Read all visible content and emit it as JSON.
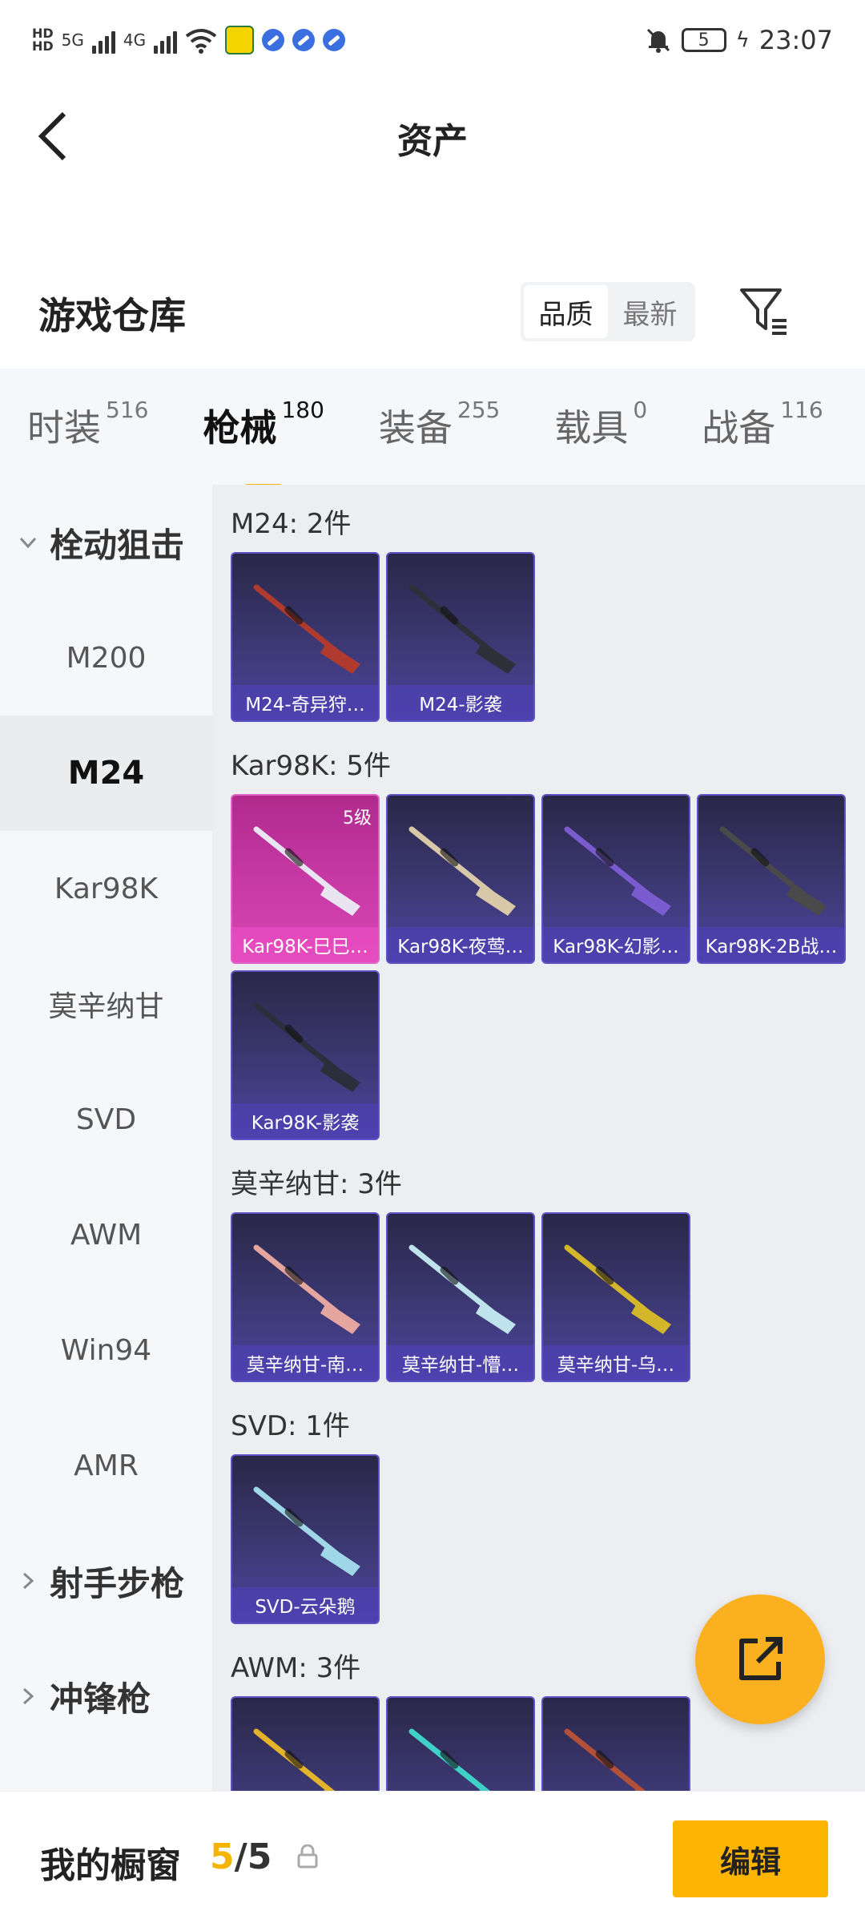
{
  "status_bar": {
    "time": "23:07",
    "battery": "5",
    "network": "5G",
    "network2": "4G",
    "icons": [
      "hd-icon",
      "signal-icon",
      "signal-icon",
      "wifi-icon",
      "app-icon",
      "app-icon",
      "app-icon",
      "app-icon",
      "mute-icon",
      "battery-icon",
      "charging-icon"
    ]
  },
  "header": {
    "title": "资产"
  },
  "section": {
    "title": "游戏仓库",
    "sort_quality": "品质",
    "sort_newest": "最新"
  },
  "tabs": [
    {
      "label": "时装",
      "count": "516"
    },
    {
      "label": "枪械",
      "count": "180"
    },
    {
      "label": "装备",
      "count": "255"
    },
    {
      "label": "载具",
      "count": "0"
    },
    {
      "label": "战备",
      "count": "116"
    }
  ],
  "sidebar": {
    "cat1": "栓动狙击",
    "items": [
      "M200",
      "M24",
      "Kar98K",
      "莫辛纳甘",
      "SVD",
      "AWM",
      "Win94",
      "AMR"
    ],
    "cat2": "射手步枪",
    "cat3": "冲锋枪"
  },
  "groups": [
    {
      "title": "M24: 2件",
      "items": [
        {
          "name": "M24-奇异狩…",
          "color": "#b03a2e"
        },
        {
          "name": "M24-影袭",
          "color": "#2f2f3a"
        }
      ]
    },
    {
      "title": "Kar98K: 5件",
      "items": [
        {
          "name": "Kar98K-巳巳…",
          "level": "5级",
          "color": "#e9e4f2"
        },
        {
          "name": "Kar98K-夜莺…",
          "color": "#d8c8a8"
        },
        {
          "name": "Kar98K-幻影…",
          "color": "#7a5bd0"
        },
        {
          "name": "Kar98K-2B战…",
          "color": "#4a4a4a"
        },
        {
          "name": "Kar98K-影袭",
          "color": "#2b2e3b"
        }
      ]
    },
    {
      "title": "莫辛纳甘: 3件",
      "items": [
        {
          "name": "莫辛纳甘-南…",
          "color": "#e6a6a0"
        },
        {
          "name": "莫辛纳甘-懵…",
          "color": "#bfe3ec"
        },
        {
          "name": "莫辛纳甘-乌…",
          "color": "#d4b62b"
        }
      ]
    },
    {
      "title": "SVD: 1件",
      "items": [
        {
          "name": "SVD-云朵鹅",
          "color": "#9fd6e8"
        }
      ]
    },
    {
      "title": "AWM: 3件",
      "items": [
        {
          "name": "",
          "color": "#e3b32a"
        },
        {
          "name": "",
          "color": "#3fd0c8"
        },
        {
          "name": "",
          "color": "#b2503a"
        }
      ]
    }
  ],
  "bottom": {
    "label": "我的橱窗",
    "current": "5",
    "slash": "/",
    "total": "5",
    "edit": "编辑"
  },
  "colors": {
    "accent": "#fbb400",
    "card_purple": "#3e3a78",
    "card_pink": "#c93aa6"
  }
}
